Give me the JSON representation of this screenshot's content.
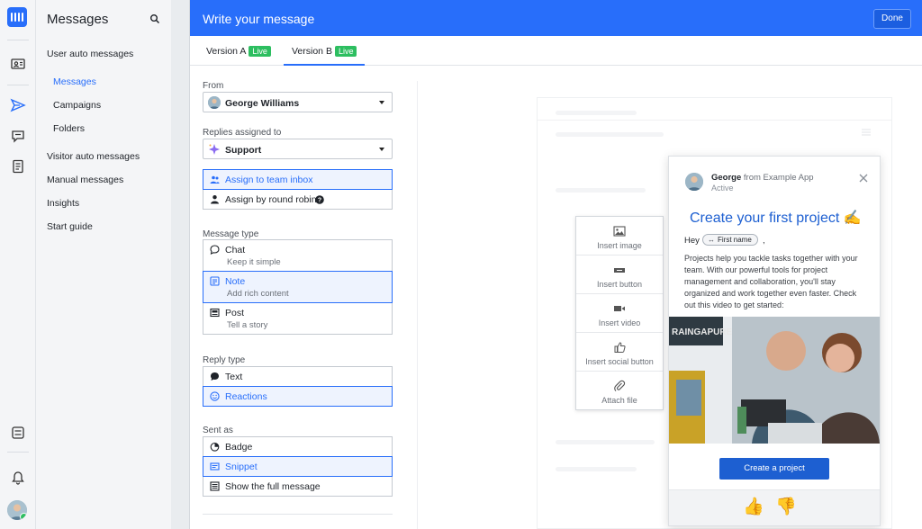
{
  "nav": {
    "title": "Messages",
    "items": [
      {
        "label": "User auto messages"
      },
      {
        "label": "Messages"
      },
      {
        "label": "Campaigns"
      },
      {
        "label": "Folders"
      },
      {
        "label": "Visitor auto messages"
      },
      {
        "label": "Manual messages"
      },
      {
        "label": "Insights"
      },
      {
        "label": "Start guide"
      }
    ]
  },
  "header": {
    "title": "Write your message",
    "done_label": "Done"
  },
  "tabs": [
    {
      "label": "Version A",
      "badge": "Live"
    },
    {
      "label": "Version B",
      "badge": "Live"
    }
  ],
  "settings": {
    "from": {
      "label": "From",
      "value": "George Williams"
    },
    "replies": {
      "label": "Replies assigned to",
      "value": "Support"
    },
    "assign": {
      "team_inbox": "Assign to team inbox",
      "round_robin": "Assign by round robin"
    },
    "message_type": {
      "label": "Message type",
      "options": [
        {
          "label": "Chat",
          "desc": "Keep it simple"
        },
        {
          "label": "Note",
          "desc": "Add rich content"
        },
        {
          "label": "Post",
          "desc": "Tell a story"
        }
      ]
    },
    "reply_type": {
      "label": "Reply type",
      "options": [
        {
          "label": "Text"
        },
        {
          "label": "Reactions"
        }
      ]
    },
    "sent_as": {
      "label": "Sent as",
      "options": [
        {
          "label": "Badge"
        },
        {
          "label": "Snippet"
        },
        {
          "label": "Show the full message"
        }
      ]
    }
  },
  "insert_menu": [
    {
      "label": "Insert image",
      "icon": "image-icon"
    },
    {
      "label": "Insert button",
      "icon": "button-icon"
    },
    {
      "label": "Insert video",
      "icon": "video-icon"
    },
    {
      "label": "Insert social button",
      "icon": "thumbs-up-icon"
    },
    {
      "label": "Attach file",
      "icon": "paperclip-icon"
    }
  ],
  "preview": {
    "sender_name": "George",
    "sender_from": "from Example App",
    "sender_status": "Active",
    "title": "Create your first project ✍",
    "greeting": "Hey",
    "chip": "First name",
    "chip_icon": "↔",
    "chip_suffix": ",",
    "body": "Projects help you tackle tasks together with your team. With our powerful tools for project management and collaboration, you'll stay organized and work together even faster. Check out this video to get started:",
    "photo_sign": "RAINGAPURE",
    "cta": "Create a project",
    "reactions": [
      "👍",
      "👎"
    ]
  },
  "colors": {
    "accent": "#286efa",
    "live": "#2dbe60",
    "title_blue": "#1d5fd1"
  }
}
